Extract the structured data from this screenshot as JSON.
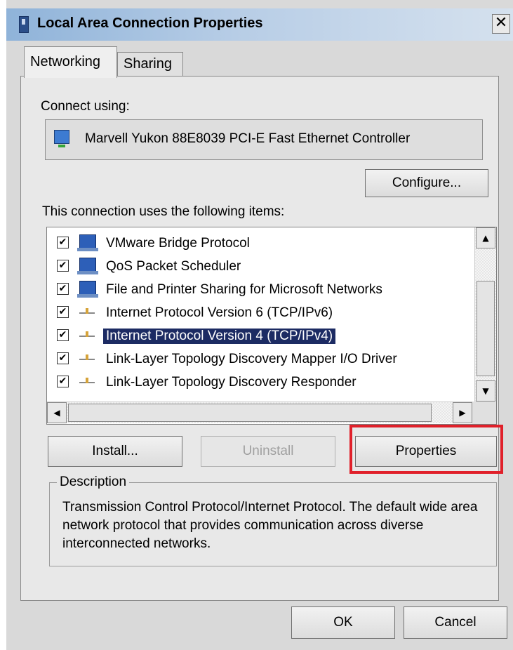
{
  "window": {
    "title": "Local Area Connection Properties",
    "close_glyph": "✕"
  },
  "tabs": [
    {
      "label": "Networking",
      "active": true
    },
    {
      "label": "Sharing",
      "active": false
    }
  ],
  "connect_using_label": "Connect using:",
  "adapter_name": "Marvell Yukon 88E8039 PCI-E Fast Ethernet Controller",
  "configure_button": "Configure...",
  "items_label": "This connection uses the following items:",
  "items": [
    {
      "label": "VMware Bridge Protocol",
      "checked": true,
      "icon": "network-service-icon",
      "selected": false
    },
    {
      "label": "QoS Packet Scheduler",
      "checked": true,
      "icon": "network-service-icon",
      "selected": false
    },
    {
      "label": "File and Printer Sharing for Microsoft Networks",
      "checked": true,
      "icon": "network-service-icon",
      "selected": false
    },
    {
      "label": "Internet Protocol Version 6 (TCP/IPv6)",
      "checked": true,
      "icon": "protocol-icon",
      "selected": false
    },
    {
      "label": "Internet Protocol Version 4 (TCP/IPv4)",
      "checked": true,
      "icon": "protocol-icon",
      "selected": true
    },
    {
      "label": "Link-Layer Topology Discovery Mapper I/O Driver",
      "checked": true,
      "icon": "protocol-icon",
      "selected": false
    },
    {
      "label": "Link-Layer Topology Discovery Responder",
      "checked": true,
      "icon": "protocol-icon",
      "selected": false
    }
  ],
  "buttons": {
    "install": "Install...",
    "uninstall": "Uninstall",
    "properties": "Properties",
    "ok": "OK",
    "cancel": "Cancel"
  },
  "description": {
    "legend": "Description",
    "text": "Transmission Control Protocol/Internet Protocol. The default wide area network protocol that provides communication across diverse interconnected networks."
  },
  "colors": {
    "selection_bg": "#1c2b63",
    "highlight_border": "#e0202a",
    "titlebar": "#b7cde6"
  }
}
